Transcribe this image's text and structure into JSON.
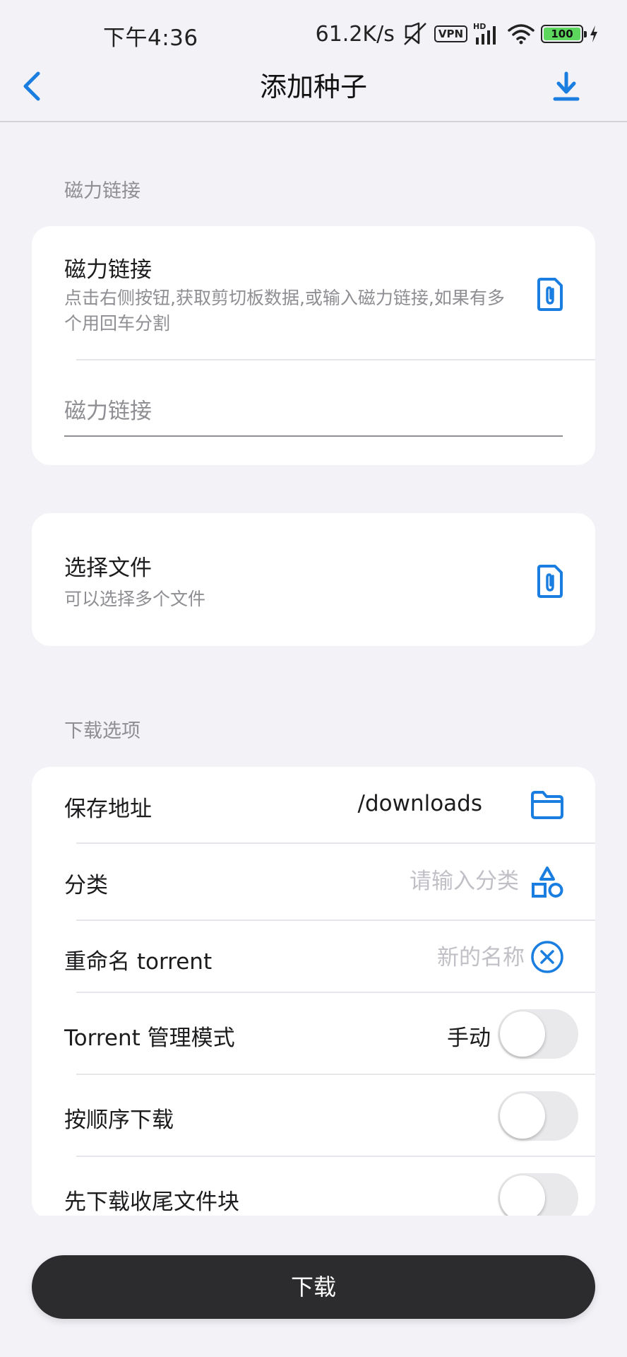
{
  "status_bar": {
    "time": "下午4:36",
    "net_speed": "61.2K/s",
    "vpn_label": "VPN",
    "signal_label": "HD",
    "battery_level": "100"
  },
  "nav": {
    "title": "添加种子",
    "back_icon": "chevron-left-icon",
    "download_icon": "download-icon"
  },
  "magnet_section": {
    "header": "磁力链接",
    "title": "磁力链接",
    "subtitle": "点击右侧按钮,获取剪切板数据,或输入磁力链接,如果有多个用回车分割",
    "input_placeholder": "磁力链接",
    "input_value": "",
    "icon": "clipboard-icon"
  },
  "file_section": {
    "title": "选择文件",
    "subtitle": "可以选择多个文件",
    "icon": "clipboard-icon"
  },
  "options_section": {
    "header": "下载选项",
    "save_path_label": "保存地址",
    "save_path_value": "/downloads",
    "category_label": "分类",
    "category_placeholder": "请输入分类",
    "rename_label": "重命名 torrent",
    "rename_placeholder": "新的名称",
    "management_label": "Torrent 管理模式",
    "management_value": "手动",
    "management_on": false,
    "sequential_label": "按顺序下载",
    "sequential_on": false,
    "first_last_label": "先下载收尾文件块",
    "first_last_on": false
  },
  "download_button": "下载",
  "colors": {
    "accent": "#1a7ee0",
    "background": "#f2f2f7",
    "card": "#ffffff",
    "button": "#2c2c2e",
    "secondary_text": "#8e8e93"
  }
}
